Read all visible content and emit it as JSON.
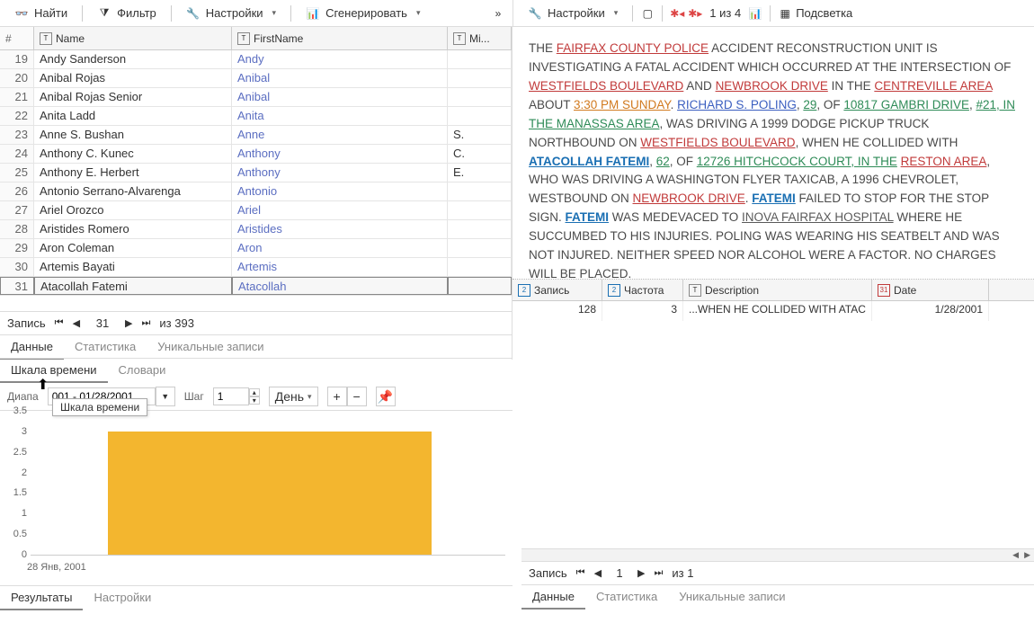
{
  "left_toolbar": {
    "find": "Найти",
    "filter": "Фильтр",
    "settings": "Настройки",
    "generate": "Сгенерировать"
  },
  "right_toolbar": {
    "settings": "Настройки",
    "nav_text": "1 из 4",
    "highlight": "Подсветка"
  },
  "grid": {
    "headers": {
      "num": "#",
      "name": "Name",
      "first": "FirstName",
      "mi": "Mi..."
    },
    "rows": [
      {
        "n": "19",
        "name": "Andy Sanderson",
        "first": "Andy",
        "mi": ""
      },
      {
        "n": "20",
        "name": "Anibal Rojas",
        "first": "Anibal",
        "mi": ""
      },
      {
        "n": "21",
        "name": "Anibal Rojas Senior",
        "first": "Anibal",
        "mi": ""
      },
      {
        "n": "22",
        "name": "Anita Ladd",
        "first": "Anita",
        "mi": ""
      },
      {
        "n": "23",
        "name": "Anne S. Bushan",
        "first": "Anne",
        "mi": "S."
      },
      {
        "n": "24",
        "name": "Anthony C. Kunec",
        "first": "Anthony",
        "mi": "C."
      },
      {
        "n": "25",
        "name": "Anthony E. Herbert",
        "first": "Anthony",
        "mi": "E."
      },
      {
        "n": "26",
        "name": "Antonio Serrano-Alvarenga",
        "first": "Antonio",
        "mi": ""
      },
      {
        "n": "27",
        "name": "Ariel Orozco",
        "first": "Ariel",
        "mi": ""
      },
      {
        "n": "28",
        "name": "Aristides Romero",
        "first": "Aristides",
        "mi": ""
      },
      {
        "n": "29",
        "name": "Aron Coleman",
        "first": "Aron",
        "mi": ""
      },
      {
        "n": "30",
        "name": "Artemis Bayati",
        "first": "Artemis",
        "mi": ""
      },
      {
        "n": "31",
        "name": "Atacollah Fatemi",
        "first": "Atacollah",
        "mi": ""
      }
    ],
    "selected_index": 12
  },
  "pager": {
    "label": "Запись",
    "current": "31",
    "total": "из 393"
  },
  "left_tabs": {
    "data": "Данные",
    "stats": "Статистика",
    "unique": "Уникальные записи"
  },
  "timeline": {
    "tab_timeline": "Шкала времени",
    "tab_dict": "Словари",
    "tooltip": "Шкала времени",
    "range_label": "Диапа",
    "range_value": "001 - 01/28/2001",
    "step_label": "Шаг",
    "step_value": "1",
    "unit": "День"
  },
  "chart_data": {
    "type": "bar",
    "categories": [
      "28 Янв, 2001"
    ],
    "values": [
      3
    ],
    "ylim": [
      0,
      3.5
    ],
    "yticks": [
      "0",
      "0.5",
      "1",
      "1.5",
      "2",
      "2.5",
      "3",
      "3.5"
    ],
    "xlabel": "28 Янв, 2001",
    "bar_color": "#f3b62f"
  },
  "results_tabs": {
    "results": "Результаты",
    "settings": "Настройки"
  },
  "doc": {
    "p1a": "THE ",
    "fairfax": "FAIRFAX COUNTY POLICE",
    "p1b": " ACCIDENT RECONSTRUCTION UNIT IS INVESTIGATING A FATAL ACCIDENT WHICH OCCURRED AT THE INTERSECTION OF ",
    "westfields1": "WESTFIELDS BOULEVARD",
    "and1": " AND ",
    "newbrook1": "NEWBROOK DRIVE",
    "inthe": " IN THE ",
    "centreville": "CENTREVILLE AREA",
    "about": " ABOUT ",
    "time": "3:30 PM SUNDAY",
    "dot1": ". ",
    "poling": "RICHARD S. POLING",
    "comma1": ", ",
    "age29": "29",
    "of": ", OF ",
    "addr1": "10817 GAMBRI DRIVE",
    "comma2": ", ",
    "unit21": "#21, IN THE MANASSAS AREA",
    "p2": ", WAS DRIVING A 1999 DODGE PICKUP TRUCK NORTHBOUND ON ",
    "westfields2": "WESTFIELDS BOULEVARD",
    "p3": ", WHEN HE COLLIDED WITH ",
    "atacollah": "ATACOLLAH FATEMI",
    "comma3": ", ",
    "age62": "62",
    "of2": ", OF ",
    "addr2": "12726 HITCHCOCK COURT, IN THE",
    "sp": " ",
    "reston": "RESTON AREA",
    "p4": ", WHO WAS DRIVING A WASHINGTON FLYER TAXICAB, A 1996 CHEVROLET, WESTBOUND ON ",
    "newbrook2": "NEWBROOK DRIVE",
    "dot2": ". ",
    "fatemi1": "FATEMI",
    "p5": " FAILED TO STOP FOR THE STOP SIGN. ",
    "fatemi2": "FATEMI",
    "p6": " WAS MEDEVACED TO ",
    "inova": "INOVA FAIRFAX HOSPITAL",
    "p7": " WHERE HE SUCCUMBED TO HIS INJURIES. POLING WAS WEARING HIS SEATBELT AND WAS NOT INJURED. NEITHER SPEED NOR ALCOHOL WERE A FACTOR. NO CHARGES WILL BE PLACED."
  },
  "mini": {
    "headers": {
      "rec": "Запись",
      "freq": "Частота",
      "desc": "Description",
      "date": "Date"
    },
    "row": {
      "rec": "128",
      "freq": "3",
      "desc": "...WHEN HE COLLIDED WITH ",
      "desc_hl": "ATAC",
      "date": "1/28/2001"
    }
  },
  "right_pager": {
    "label": "Запись",
    "current": "1",
    "total": "из 1"
  },
  "right_tabs": {
    "data": "Данные",
    "stats": "Статистика",
    "unique": "Уникальные записи"
  }
}
